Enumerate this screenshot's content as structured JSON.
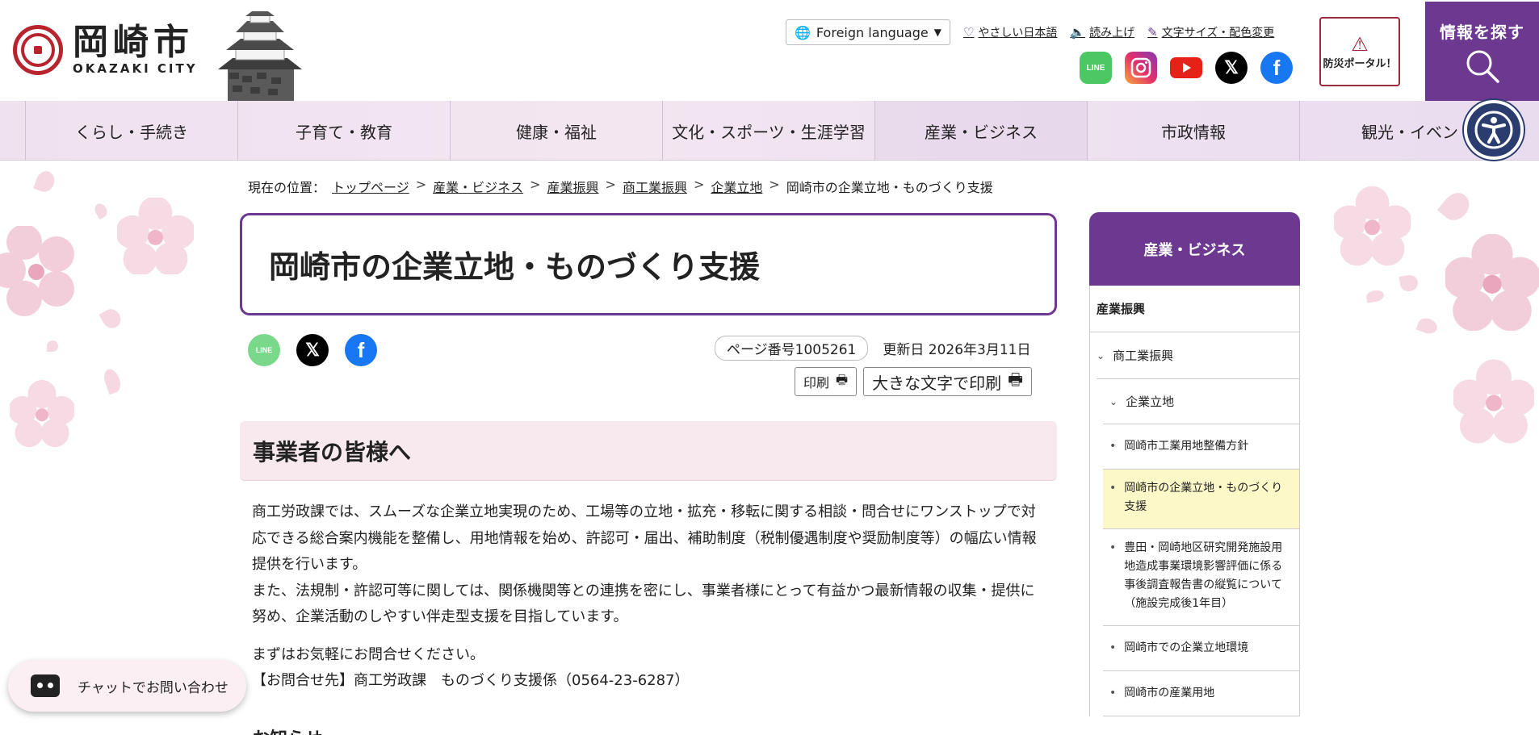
{
  "header": {
    "logo_jp": "岡崎市",
    "logo_en": "OKAZAKI CITY",
    "lang_label": "Foreign language",
    "util_links": [
      "やさしい日本語",
      "読み上げ",
      "文字サイズ・配色変更"
    ],
    "sns": [
      "LINE",
      "Instagram",
      "YouTube",
      "X",
      "Facebook"
    ],
    "bosai_label": "防災ポータル！",
    "search_label": "情報を探す"
  },
  "gnav": [
    "くらし・手続き",
    "子育て・教育",
    "健康・福祉",
    "文化・スポーツ・生涯学習",
    "産業・ビジネス",
    "市政情報",
    "観光・イベント"
  ],
  "breadcrumb": {
    "prefix": "現在の位置：",
    "items": [
      "トップページ",
      "産業・ビジネス",
      "産業振興",
      "商工業振興",
      "企業立地"
    ],
    "current": "岡崎市の企業立地・ものづくり支援"
  },
  "page": {
    "title": "岡崎市の企業立地・ものづくり支援",
    "page_number": "ページ番号1005261",
    "updated": "更新日 2026年3月11日",
    "print": "印刷",
    "print_large": "大きな文字で印刷"
  },
  "section": {
    "heading": "事業者の皆様へ",
    "p1": "商工労政課では、スムーズな企業立地実現のため、工場等の立地・拡充・移転に関する相談・問合せにワンストップで対応できる総合案内機能を整備し、用地情報を始め、許認可・届出、補助制度（税制優遇制度や奨励制度等）の幅広い情報提供を行います。",
    "p2": "また、法規制・許認可等に関しては、関係機関等との連携を密にし、事業者様にとって有益かつ最新情報の収集・提供に努め、企業活動のしやすい伴走型支援を目指しています。",
    "p3": "まずはお気軽にお問合せください。",
    "p4": "【お問合せ先】商工労政課　ものづくり支援係（0564-23-6287）",
    "next_heading": "お知らせ"
  },
  "chat_label": "チャットでお問い合わせ",
  "sidenav": {
    "head": "産業・ビジネス",
    "l1": "産業振興",
    "l2": "商工業振興",
    "l3": "企業立地",
    "items": [
      "岡崎市工業用地整備方針",
      "岡崎市の企業立地・ものづくり支援",
      "豊田・岡崎地区研究開発施設用地造成事業環境影響評価に係る事後調査報告書の縦覧について（施設完成後1年目）",
      "岡崎市での企業立地環境",
      "岡崎市の産業用地"
    ]
  },
  "colors": {
    "brand_purple": "#6c3890",
    "nav_bg": "#efe1ee",
    "active_bg": "#fcf8c8",
    "section_bg": "#f8e9ee"
  }
}
